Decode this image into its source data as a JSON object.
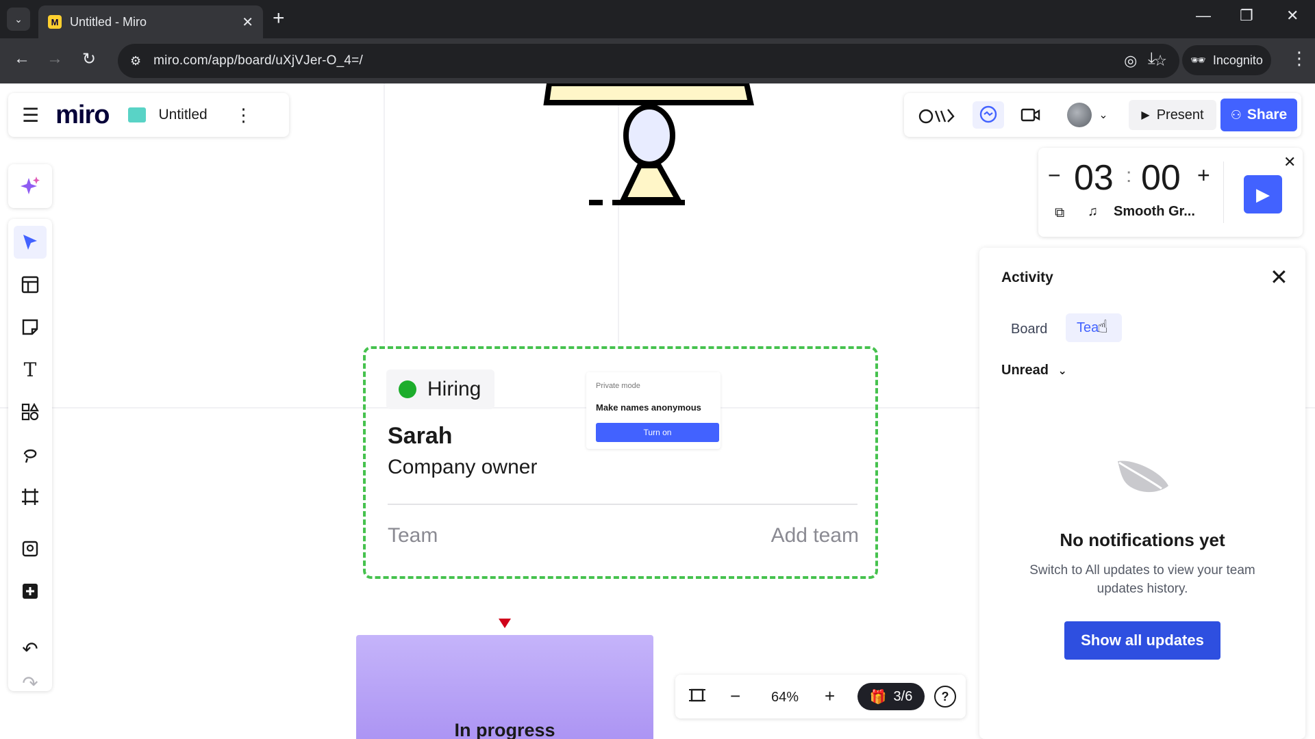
{
  "browser": {
    "tab_title": "Untitled - Miro",
    "url": "miro.com/app/board/uXjVJer-O_4=/",
    "incognito_label": "Incognito",
    "favicon_letter": "M"
  },
  "board": {
    "logo": "miro",
    "title": "Untitled"
  },
  "top_toolbar": {
    "present_label": "Present",
    "share_label": "Share"
  },
  "timer": {
    "minutes": "03",
    "seconds": "00",
    "music_label": "Smooth Gr..."
  },
  "activity": {
    "title": "Activity",
    "tabs": [
      {
        "label": "Board"
      },
      {
        "label": "Tea"
      }
    ],
    "filter_label": "Unread",
    "empty_title": "No notifications yet",
    "empty_text": "Switch to All updates to view your team updates history.",
    "show_all_label": "Show all updates"
  },
  "card": {
    "status": "Hiring",
    "name": "Sarah",
    "role": "Company owner",
    "team_label": "Team",
    "add_team_label": "Add team",
    "private_mode_label": "Private mode",
    "private_mode_title": "Make names anonymous",
    "private_mode_button": "Turn on"
  },
  "progress_card": {
    "label": "In progress"
  },
  "zoom": {
    "level": "64%",
    "counter": "3/6"
  },
  "colors": {
    "accent": "#4262ff",
    "status_green": "#1dad2c",
    "card_border": "#46c24e"
  }
}
